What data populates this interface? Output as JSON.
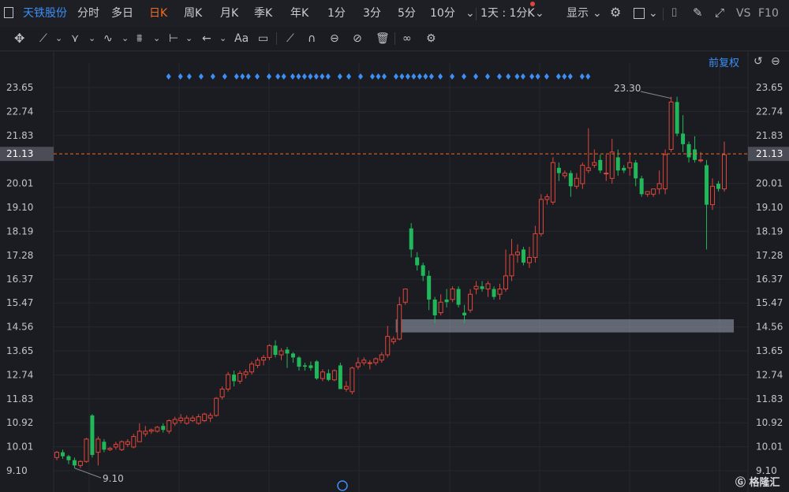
{
  "toolbar": {
    "stock_name": "天铁股份",
    "periods": [
      "分时",
      "多日",
      "日K",
      "周K",
      "月K",
      "季K",
      "年K",
      "1分",
      "3分",
      "5分",
      "10分"
    ],
    "active_period": "日K",
    "multi_period": "1天 : 1分K",
    "display_label": "显示",
    "vs_label": "VS",
    "f10_label": "F10"
  },
  "adjust_label": "前复权",
  "watermark": "格隆汇",
  "colors": {
    "up": "#e0463b",
    "down": "#21b85b",
    "price_line": "#f26c22",
    "diamond": "#3c8ff5",
    "zone": "#9aa6b8"
  },
  "chart_data": {
    "type": "candlestick",
    "y_ticks": [
      "23.65",
      "22.74",
      "21.83",
      "20.01",
      "19.10",
      "18.19",
      "17.28",
      "16.37",
      "15.47",
      "14.56",
      "13.65",
      "12.74",
      "11.83",
      "10.92",
      "10.01",
      "9.10"
    ],
    "ylim": [
      9.1,
      23.65
    ],
    "current_price": "21.13",
    "high_label": "23.30",
    "low_label": "9.10",
    "price_zone": [
      14.35,
      14.85
    ],
    "candles": [
      [
        9.6,
        9.8,
        9.5,
        9.85
      ],
      [
        9.8,
        9.65,
        9.55,
        9.9
      ],
      [
        9.65,
        9.5,
        9.35,
        9.7
      ],
      [
        9.5,
        9.3,
        9.2,
        9.6
      ],
      [
        9.3,
        9.45,
        9.2,
        9.5
      ],
      [
        9.45,
        10.3,
        9.4,
        10.35
      ],
      [
        11.2,
        9.7,
        9.6,
        11.25
      ],
      [
        9.8,
        10.3,
        9.3,
        10.4
      ],
      [
        10.2,
        9.9,
        9.8,
        10.3
      ],
      [
        9.9,
        9.95,
        9.85,
        10.0
      ],
      [
        10.0,
        10.1,
        9.9,
        10.2
      ],
      [
        9.9,
        10.2,
        9.85,
        10.25
      ],
      [
        10.1,
        10.2,
        10.0,
        10.3
      ],
      [
        10.0,
        10.4,
        9.95,
        10.5
      ],
      [
        10.2,
        10.6,
        10.2,
        10.9
      ],
      [
        10.5,
        10.6,
        10.4,
        10.8
      ],
      [
        10.6,
        10.65,
        10.5,
        10.7
      ],
      [
        10.6,
        10.75,
        10.55,
        10.8
      ],
      [
        10.8,
        10.65,
        10.55,
        10.9
      ],
      [
        10.6,
        11.0,
        10.5,
        11.05
      ],
      [
        10.9,
        11.05,
        10.8,
        11.15
      ],
      [
        11.0,
        11.1,
        10.9,
        11.25
      ],
      [
        10.9,
        11.1,
        10.85,
        11.2
      ],
      [
        11.0,
        11.1,
        10.95,
        11.2
      ],
      [
        10.9,
        11.15,
        10.85,
        11.25
      ],
      [
        11.0,
        11.25,
        10.95,
        11.3
      ],
      [
        11.1,
        11.2,
        10.95,
        11.3
      ],
      [
        11.2,
        11.85,
        11.15,
        11.9
      ],
      [
        11.9,
        12.2,
        11.8,
        12.3
      ],
      [
        12.2,
        12.75,
        12.1,
        12.85
      ],
      [
        12.75,
        12.5,
        12.3,
        12.9
      ],
      [
        12.5,
        12.8,
        12.4,
        12.9
      ],
      [
        12.75,
        12.85,
        12.6,
        12.95
      ],
      [
        12.85,
        13.15,
        12.75,
        13.25
      ],
      [
        13.1,
        13.3,
        13.0,
        13.4
      ],
      [
        13.3,
        13.4,
        13.1,
        13.5
      ],
      [
        13.4,
        13.85,
        13.3,
        13.9
      ],
      [
        13.85,
        13.5,
        13.4,
        14.05
      ],
      [
        13.5,
        13.65,
        13.3,
        13.75
      ],
      [
        13.7,
        13.55,
        13.0,
        13.8
      ],
      [
        13.55,
        13.4,
        13.2,
        13.6
      ],
      [
        13.4,
        13.05,
        12.9,
        13.45
      ],
      [
        13.1,
        13.05,
        12.9,
        13.2
      ],
      [
        13.1,
        13.0,
        12.9,
        13.25
      ],
      [
        13.25,
        12.6,
        12.55,
        13.3
      ],
      [
        12.6,
        12.85,
        12.5,
        12.95
      ],
      [
        12.8,
        12.55,
        12.5,
        12.95
      ],
      [
        12.55,
        12.9,
        12.5,
        12.95
      ],
      [
        13.1,
        12.2,
        12.2,
        13.2
      ],
      [
        12.2,
        12.3,
        12.1,
        12.5
      ],
      [
        12.1,
        13.0,
        12.0,
        13.05
      ],
      [
        13.05,
        13.2,
        12.95,
        13.4
      ],
      [
        13.2,
        13.3,
        13.1,
        13.4
      ],
      [
        13.2,
        13.2,
        12.95,
        13.3
      ],
      [
        13.2,
        13.35,
        13.1,
        13.4
      ],
      [
        13.3,
        13.5,
        13.2,
        13.6
      ],
      [
        13.5,
        14.2,
        13.4,
        14.6
      ],
      [
        14.0,
        14.1,
        13.9,
        14.2
      ],
      [
        14.1,
        15.4,
        14.05,
        15.7
      ],
      [
        15.5,
        16.0,
        15.4,
        16.0
      ],
      [
        18.3,
        17.5,
        17.2,
        18.5
      ],
      [
        17.2,
        16.9,
        16.7,
        17.4
      ],
      [
        16.9,
        16.5,
        16.3,
        17.0
      ],
      [
        16.5,
        15.6,
        15.2,
        16.7
      ],
      [
        15.6,
        15.0,
        14.7,
        15.7
      ],
      [
        15.1,
        15.5,
        15.0,
        15.8
      ],
      [
        15.6,
        15.5,
        15.3,
        16.0
      ],
      [
        15.6,
        16.0,
        15.5,
        16.1
      ],
      [
        16.0,
        15.4,
        15.3,
        16.1
      ],
      [
        15.1,
        15.0,
        14.7,
        15.4
      ],
      [
        15.2,
        15.8,
        15.1,
        16.0
      ],
      [
        16.0,
        16.1,
        15.8,
        16.3
      ],
      [
        16.1,
        16.0,
        15.9,
        16.3
      ],
      [
        16.0,
        16.2,
        15.7,
        16.3
      ],
      [
        16.0,
        15.7,
        15.6,
        16.1
      ],
      [
        15.8,
        16.0,
        15.6,
        16.2
      ],
      [
        16.0,
        16.5,
        15.9,
        17.5
      ],
      [
        16.5,
        17.3,
        16.3,
        17.9
      ],
      [
        17.3,
        17.4,
        17.0,
        17.7
      ],
      [
        17.5,
        17.0,
        16.9,
        17.6
      ],
      [
        17.0,
        17.2,
        16.8,
        17.6
      ],
      [
        17.2,
        18.1,
        17.0,
        18.4
      ],
      [
        18.1,
        19.4,
        18.0,
        19.6
      ],
      [
        19.4,
        19.5,
        19.2,
        19.6
      ],
      [
        19.3,
        20.8,
        19.2,
        21.0
      ],
      [
        20.6,
        20.4,
        20.1,
        20.8
      ],
      [
        20.3,
        20.4,
        20.2,
        20.5
      ],
      [
        20.4,
        19.9,
        19.5,
        20.5
      ],
      [
        19.9,
        20.2,
        19.8,
        20.4
      ],
      [
        20.0,
        20.7,
        19.8,
        20.8
      ],
      [
        20.5,
        20.6,
        20.4,
        22.1
      ],
      [
        20.7,
        20.8,
        20.6,
        21.3
      ],
      [
        20.9,
        20.5,
        20.4,
        21.1
      ],
      [
        20.4,
        20.4,
        20.1,
        21.1
      ],
      [
        20.2,
        21.2,
        20.0,
        21.7
      ],
      [
        21.0,
        20.5,
        20.3,
        21.3
      ],
      [
        20.6,
        20.5,
        20.4,
        20.7
      ],
      [
        20.6,
        20.8,
        20.3,
        21.2
      ],
      [
        20.8,
        20.2,
        19.9,
        20.9
      ],
      [
        20.2,
        19.6,
        19.5,
        20.3
      ],
      [
        19.6,
        19.7,
        19.5,
        19.7
      ],
      [
        19.6,
        19.8,
        19.5,
        19.8
      ],
      [
        19.8,
        20.0,
        19.6,
        20.5
      ],
      [
        19.8,
        21.1,
        19.6,
        21.3
      ],
      [
        21.3,
        23.1,
        21.2,
        23.3
      ],
      [
        23.1,
        21.9,
        21.8,
        23.3
      ],
      [
        21.9,
        21.5,
        21.2,
        22.6
      ],
      [
        21.5,
        21.0,
        20.8,
        21.6
      ],
      [
        21.3,
        20.9,
        20.8,
        21.8
      ],
      [
        20.9,
        20.9,
        20.8,
        21.2
      ],
      [
        20.7,
        19.2,
        17.5,
        20.9
      ],
      [
        19.2,
        19.9,
        19.0,
        20.2
      ],
      [
        20.0,
        19.8,
        19.7,
        20.1
      ],
      [
        19.8,
        21.1,
        19.7,
        21.6
      ]
    ],
    "signal_marks": [
      9,
      13,
      16,
      20,
      24,
      28,
      32,
      34,
      36,
      39,
      43,
      46,
      48,
      51,
      53,
      55,
      57,
      59,
      61,
      63,
      67,
      70,
      74,
      78,
      80,
      82,
      86,
      88,
      90,
      92,
      94,
      96,
      98,
      101,
      105,
      109,
      113,
      117,
      121,
      124,
      127,
      129,
      132,
      134,
      137,
      141,
      143,
      145,
      149,
      151
    ]
  }
}
